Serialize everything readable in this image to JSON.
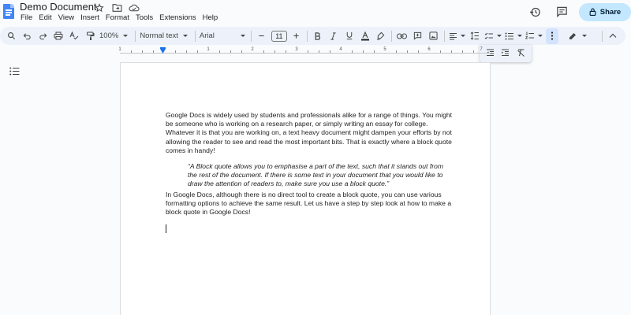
{
  "header": {
    "title": "Demo Document",
    "menu": [
      "File",
      "Edit",
      "View",
      "Insert",
      "Format",
      "Tools",
      "Extensions",
      "Help"
    ],
    "share_label": "Share",
    "title_icons": [
      "star-icon",
      "move-folder-icon",
      "cloud-saved-icon"
    ],
    "right_icons": [
      "history-icon",
      "comments-icon",
      "lock-icon"
    ],
    "accent_color": "#c2e7ff"
  },
  "toolbar": {
    "zoom": "100%",
    "style": "Normal text",
    "font": "Arial",
    "font_size": "11",
    "icons": [
      "search-icon",
      "undo-icon",
      "redo-icon",
      "print-icon",
      "spellcheck-icon",
      "paint-format-icon",
      "bold-icon",
      "italic-icon",
      "underline-icon",
      "text-color-icon",
      "highlight-icon",
      "link-icon",
      "comment-icon",
      "image-icon",
      "align-icon",
      "line-spacing-icon",
      "checklist-icon",
      "bulleted-list-icon",
      "numbered-list-icon",
      "more-icon",
      "editing-mode-icon",
      "collapse-icon"
    ],
    "text_color_bar": "#1f1f1f"
  },
  "popup": {
    "icons": [
      "decrease-indent-icon",
      "increase-indent-icon",
      "clear-formatting-icon"
    ]
  },
  "ruler": {
    "numbers": [
      "1",
      "1",
      "2",
      "3",
      "4",
      "5",
      "6",
      "7"
    ]
  },
  "document": {
    "paragraph1": "Google Docs is widely used by students and professionals alike for a range of things. You might be someone who is working on a research paper, or simply writing an essay for college. Whatever it is that you are working on, a text heavy document might dampen your efforts by not allowing the reader to see and read the most important bits. That is exactly where a block quote comes in handy!",
    "quote": "“A Block quote allows you to emphasise a part of the text, such that it stands out from the rest of the document. If there is some text in your document that you would like to draw the attention of readers to, make sure you use a block quote.”",
    "paragraph2": "In Google Docs, although there is no direct tool to create a block quote, you can use various formatting options to achieve the same result. Let us have a step by step look at how to make a block quote in Google Docs!"
  }
}
